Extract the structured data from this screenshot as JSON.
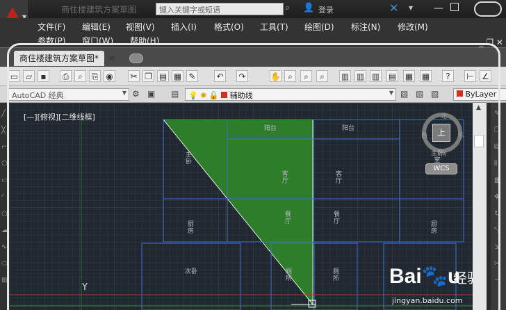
{
  "titlebar": {
    "title": "商住楼建筑方案草图",
    "search_placeholder": "键入关键字或短语",
    "login_label": "登录"
  },
  "menu": {
    "row1": [
      "文件(F)",
      "编辑(E)",
      "视图(V)",
      "插入(I)",
      "格式(O)",
      "工具(T)",
      "绘图(D)",
      "标注(N)",
      "修改(M)"
    ],
    "row2": [
      "参数(P)",
      "窗口(W)",
      "帮助(H)"
    ],
    "doc_controls": "_ ❐ ✕"
  },
  "tabs": {
    "active": "商住楼建筑方案草图*",
    "close": "✕"
  },
  "toolbar2": {
    "workspace": "AutoCAD 经典",
    "layer": "辅助线",
    "linetype": "ByLayer"
  },
  "canvas": {
    "viewport_label": "[—][俯视][二维线框]",
    "rooms": [
      {
        "id": "balcony-1",
        "text": "阳台"
      },
      {
        "id": "balcony-2",
        "text": "阳台"
      },
      {
        "id": "bedroom-left",
        "text": "主\n卧"
      },
      {
        "id": "bedroom-right",
        "text": "主卧\n室"
      },
      {
        "id": "living-1",
        "text": "客\n厅"
      },
      {
        "id": "living-2",
        "text": "客\n厅"
      },
      {
        "id": "dining-1",
        "text": "餐\n厅"
      },
      {
        "id": "dining-2",
        "text": "餐\n厅"
      },
      {
        "id": "kitchen-1",
        "text": "厨\n房"
      },
      {
        "id": "kitchen-2",
        "text": "厨\n房"
      },
      {
        "id": "second-bedroom",
        "text": "次卧"
      },
      {
        "id": "bath-1",
        "text": "厕\n所"
      },
      {
        "id": "bath-2",
        "text": "厕\n所"
      }
    ],
    "viewcube": {
      "top": "上",
      "north": "北",
      "west": "西",
      "east": "东",
      "south": "南",
      "wcs": "WCS"
    },
    "ucs_axis": "Y"
  },
  "watermark": {
    "logo": "Bai🐾u",
    "jingyan": "经验",
    "url": "jingyan.baidu.com"
  },
  "colors": {
    "canvas_bg": "#212830",
    "grid": "#2e3846",
    "wall": "#3f6fd8",
    "hatch": "#2e7d2a",
    "red_line": "#c03030"
  }
}
